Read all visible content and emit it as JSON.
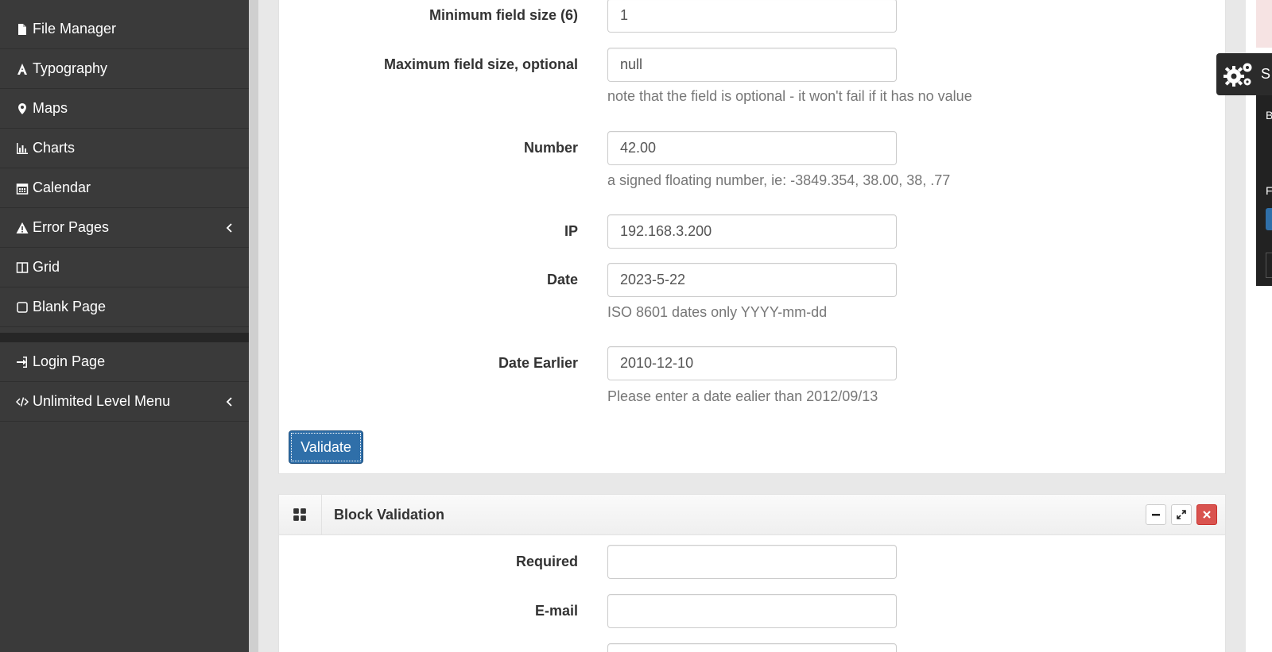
{
  "sidebar": {
    "items": [
      {
        "label": "File Manager",
        "icon": "file-icon"
      },
      {
        "label": "Typography",
        "icon": "font-icon"
      },
      {
        "label": "Maps",
        "icon": "map-marker-icon"
      },
      {
        "label": "Charts",
        "icon": "bar-chart-icon"
      },
      {
        "label": "Calendar",
        "icon": "calendar-icon"
      },
      {
        "label": "Error Pages",
        "icon": "warning-icon",
        "has_submenu": true
      },
      {
        "label": "Grid",
        "icon": "columns-icon"
      },
      {
        "label": "Blank Page",
        "icon": "square-icon"
      },
      {
        "label": "Login Page",
        "icon": "sign-in-icon"
      },
      {
        "label": "Unlimited Level Menu",
        "icon": "code-icon",
        "has_submenu": true
      }
    ]
  },
  "form": {
    "min_size": {
      "label": "Minimum field size (6)",
      "value": "1"
    },
    "max_size": {
      "label": "Maximum field size, optional",
      "value": "null",
      "help": "note that the field is optional - it won't fail if it has no value"
    },
    "number": {
      "label": "Number",
      "value": "42.00",
      "help": "a signed floating number, ie: -3849.354, 38.00, 38, .77"
    },
    "ip": {
      "label": "IP",
      "value": "192.168.3.200"
    },
    "date": {
      "label": "Date",
      "value": "2023-5-22",
      "help": "ISO 8601 dates only YYYY-mm-dd"
    },
    "date_earlier": {
      "label": "Date Earlier",
      "value": "2010-12-10",
      "help": "Please enter a date ealier than 2012/09/13"
    },
    "validate_label": "Validate"
  },
  "block_validation": {
    "title": "Block Validation",
    "required": {
      "label": "Required",
      "value": ""
    },
    "email": {
      "label": "E-mail",
      "value": ""
    }
  },
  "settings": {
    "tab_letter": "S",
    "side_letter_b": "B",
    "side_letter_f": "F"
  },
  "colors": {
    "sidebar_bg": "#3a3a3a",
    "primary_button": "#2f6fa9",
    "close_button": "#d9534f"
  }
}
